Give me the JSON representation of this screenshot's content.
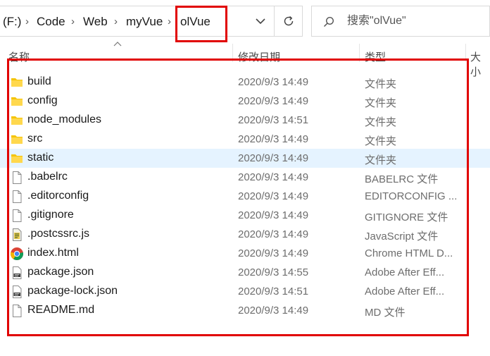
{
  "address_bar": {
    "crumbs": [
      "(F:)",
      "Code",
      "Web",
      "myVue",
      "olVue"
    ]
  },
  "search": {
    "placeholder": "搜索\"olVue\""
  },
  "columns": {
    "name": "名称",
    "modified": "修改日期",
    "type": "类型",
    "size": "大小"
  },
  "files": [
    {
      "name": "build",
      "date": "2020/9/3 14:49",
      "type": "文件夹",
      "icon": "folder-icon"
    },
    {
      "name": "config",
      "date": "2020/9/3 14:49",
      "type": "文件夹",
      "icon": "folder-icon"
    },
    {
      "name": "node_modules",
      "date": "2020/9/3 14:51",
      "type": "文件夹",
      "icon": "folder-icon"
    },
    {
      "name": "src",
      "date": "2020/9/3 14:49",
      "type": "文件夹",
      "icon": "folder-icon"
    },
    {
      "name": "static",
      "date": "2020/9/3 14:49",
      "type": "文件夹",
      "icon": "folder-icon",
      "selected": true
    },
    {
      "name": ".babelrc",
      "date": "2020/9/3 14:49",
      "type": "BABELRC 文件",
      "icon": "file-icon"
    },
    {
      "name": ".editorconfig",
      "date": "2020/9/3 14:49",
      "type": "EDITORCONFIG ...",
      "icon": "file-icon"
    },
    {
      "name": ".gitignore",
      "date": "2020/9/3 14:49",
      "type": "GITIGNORE 文件",
      "icon": "file-icon"
    },
    {
      "name": ".postcssrc.js",
      "date": "2020/9/3 14:49",
      "type": "JavaScript 文件",
      "icon": "js-script-icon"
    },
    {
      "name": "index.html",
      "date": "2020/9/3 14:49",
      "type": "Chrome HTML D...",
      "icon": "chrome-icon"
    },
    {
      "name": "package.json",
      "date": "2020/9/3 14:55",
      "type": "Adobe After Eff...",
      "icon": "json-file-icon"
    },
    {
      "name": "package-lock.json",
      "date": "2020/9/3 14:51",
      "type": "Adobe After Eff...",
      "icon": "json-file-icon"
    },
    {
      "name": "README.md",
      "date": "2020/9/3 14:49",
      "type": "MD 文件",
      "icon": "file-icon"
    }
  ],
  "colors": {
    "highlight": "#e10000",
    "selected_row": "#e5f3ff",
    "folder": "#f5c400"
  }
}
